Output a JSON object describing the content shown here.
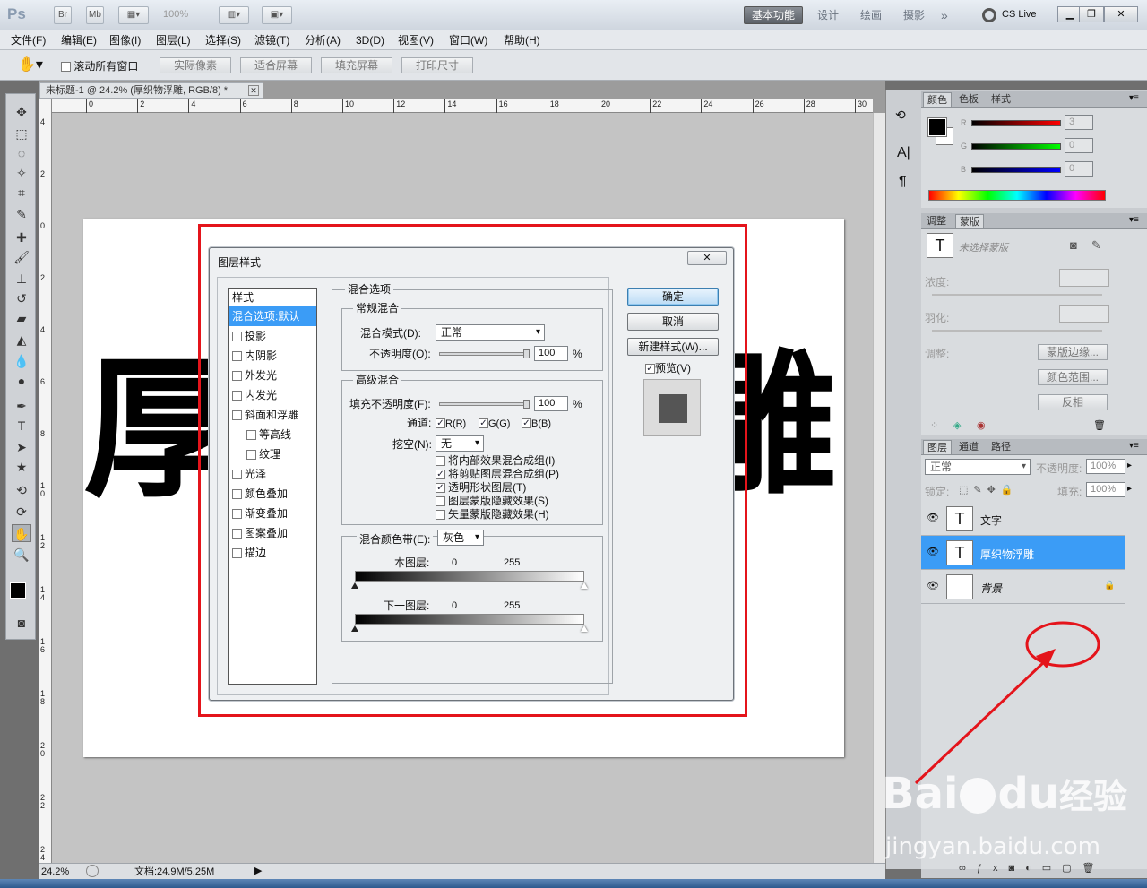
{
  "app": {
    "logo": "Ps",
    "bridge": "Br",
    "minibridge": "Mb",
    "zoom": "100%",
    "workspaces": [
      "基本功能",
      "设计",
      "绘画",
      "摄影"
    ],
    "more": "»",
    "cslive": "CS Live"
  },
  "menu": [
    "文件(F)",
    "编辑(E)",
    "图像(I)",
    "图层(L)",
    "选择(S)",
    "滤镜(T)",
    "分析(A)",
    "3D(D)",
    "视图(V)",
    "窗口(W)",
    "帮助(H)"
  ],
  "options": {
    "scroll_all": "滚动所有窗口",
    "actual_pixels": "实际像素",
    "fit_screen": "适合屏幕",
    "fill_screen": "填充屏幕",
    "print_size": "打印尺寸"
  },
  "document": {
    "tab_title": "未标题-1 @ 24.2% (厚织物浮雕, RGB/8) *",
    "canvas_text_left": "厚",
    "canvas_text_right": "雕",
    "zoom": "24.2%",
    "doc_size": "文档:24.9M/5.25M",
    "ruler_top": [
      "0",
      "2",
      "4",
      "6",
      "8",
      "10",
      "12",
      "14",
      "16",
      "18",
      "20",
      "22",
      "24",
      "26",
      "28",
      "30"
    ],
    "ruler_left": [
      "4",
      "2",
      "0",
      "2",
      "4",
      "6",
      "8",
      "1 0",
      "1 2",
      "1 4",
      "1 6",
      "1 8",
      "2 0",
      "2 2",
      "2 4"
    ]
  },
  "dialog": {
    "title": "图层样式",
    "styles_header": "样式",
    "styles": [
      {
        "label": "混合选项:默认",
        "checkbox": false,
        "selected": true,
        "sub": false
      },
      {
        "label": "投影",
        "checkbox": true,
        "selected": false,
        "sub": false
      },
      {
        "label": "内阴影",
        "checkbox": true,
        "selected": false,
        "sub": false
      },
      {
        "label": "外发光",
        "checkbox": true,
        "selected": false,
        "sub": false
      },
      {
        "label": "内发光",
        "checkbox": true,
        "selected": false,
        "sub": false
      },
      {
        "label": "斜面和浮雕",
        "checkbox": true,
        "selected": false,
        "sub": false
      },
      {
        "label": "等高线",
        "checkbox": true,
        "selected": false,
        "sub": true
      },
      {
        "label": "纹理",
        "checkbox": true,
        "selected": false,
        "sub": true
      },
      {
        "label": "光泽",
        "checkbox": true,
        "selected": false,
        "sub": false
      },
      {
        "label": "颜色叠加",
        "checkbox": true,
        "selected": false,
        "sub": false
      },
      {
        "label": "渐变叠加",
        "checkbox": true,
        "selected": false,
        "sub": false
      },
      {
        "label": "图案叠加",
        "checkbox": true,
        "selected": false,
        "sub": false
      },
      {
        "label": "描边",
        "checkbox": true,
        "selected": false,
        "sub": false
      }
    ],
    "blend_options": "混合选项",
    "general_blend": "常规混合",
    "blend_mode_label": "混合模式(D):",
    "blend_mode_value": "正常",
    "opacity_label": "不透明度(O):",
    "opacity_value": "100",
    "percent": "%",
    "advanced_blend": "高级混合",
    "fill_opacity_label": "填充不透明度(F):",
    "fill_opacity_value": "100",
    "channels_label": "通道:",
    "channels": [
      "R(R)",
      "G(G)",
      "B(B)"
    ],
    "knockout_label": "挖空(N):",
    "knockout_value": "无",
    "adv_checks": [
      {
        "label": "将内部效果混合成组(I)",
        "checked": false
      },
      {
        "label": "将剪贴图层混合成组(P)",
        "checked": true
      },
      {
        "label": "透明形状图层(T)",
        "checked": true
      },
      {
        "label": "图层蒙版隐藏效果(S)",
        "checked": false
      },
      {
        "label": "矢量蒙版隐藏效果(H)",
        "checked": false
      }
    ],
    "blend_if_label": "混合颜色带(E):",
    "blend_if_value": "灰色",
    "this_layer": "本图层:",
    "underlying_layer": "下一图层:",
    "range_min": "0",
    "range_max": "255",
    "ok": "确定",
    "cancel": "取消",
    "new_style": "新建样式(W)...",
    "preview": "预览(V)"
  },
  "panels": {
    "color_tabs": [
      "颜色",
      "色板",
      "样式"
    ],
    "rgb": [
      {
        "ch": "R",
        "value": "3"
      },
      {
        "ch": "G",
        "value": "0"
      },
      {
        "ch": "B",
        "value": "0"
      }
    ],
    "adjust_tabs": [
      "调整",
      "蒙版"
    ],
    "mask_none": "未选择蒙版",
    "density": "浓度:",
    "feather": "羽化:",
    "refine": "调整:",
    "mask_edge": "蒙版边缘...",
    "color_range": "颜色范围...",
    "invert": "反相",
    "layers_tabs": [
      "图层",
      "通道",
      "路径"
    ],
    "layer_blend": "正常",
    "layer_opacity_label": "不透明度:",
    "layer_opacity": "100%",
    "lock_label": "锁定:",
    "fill_label": "填充:",
    "fill_value": "100%",
    "layers": [
      {
        "name": "文字",
        "thumb": "T",
        "selected": false
      },
      {
        "name": "厚织物浮雕",
        "thumb": "T",
        "selected": true
      },
      {
        "name": "背景",
        "thumb": "",
        "selected": false
      }
    ]
  },
  "watermark": {
    "brand": "Bai",
    "brand2": "du",
    "product": "经验",
    "url": "jingyan.baidu.com"
  },
  "colors": {
    "highlight_red": "#e4141b",
    "selection_blue": "#3b9cf6"
  }
}
